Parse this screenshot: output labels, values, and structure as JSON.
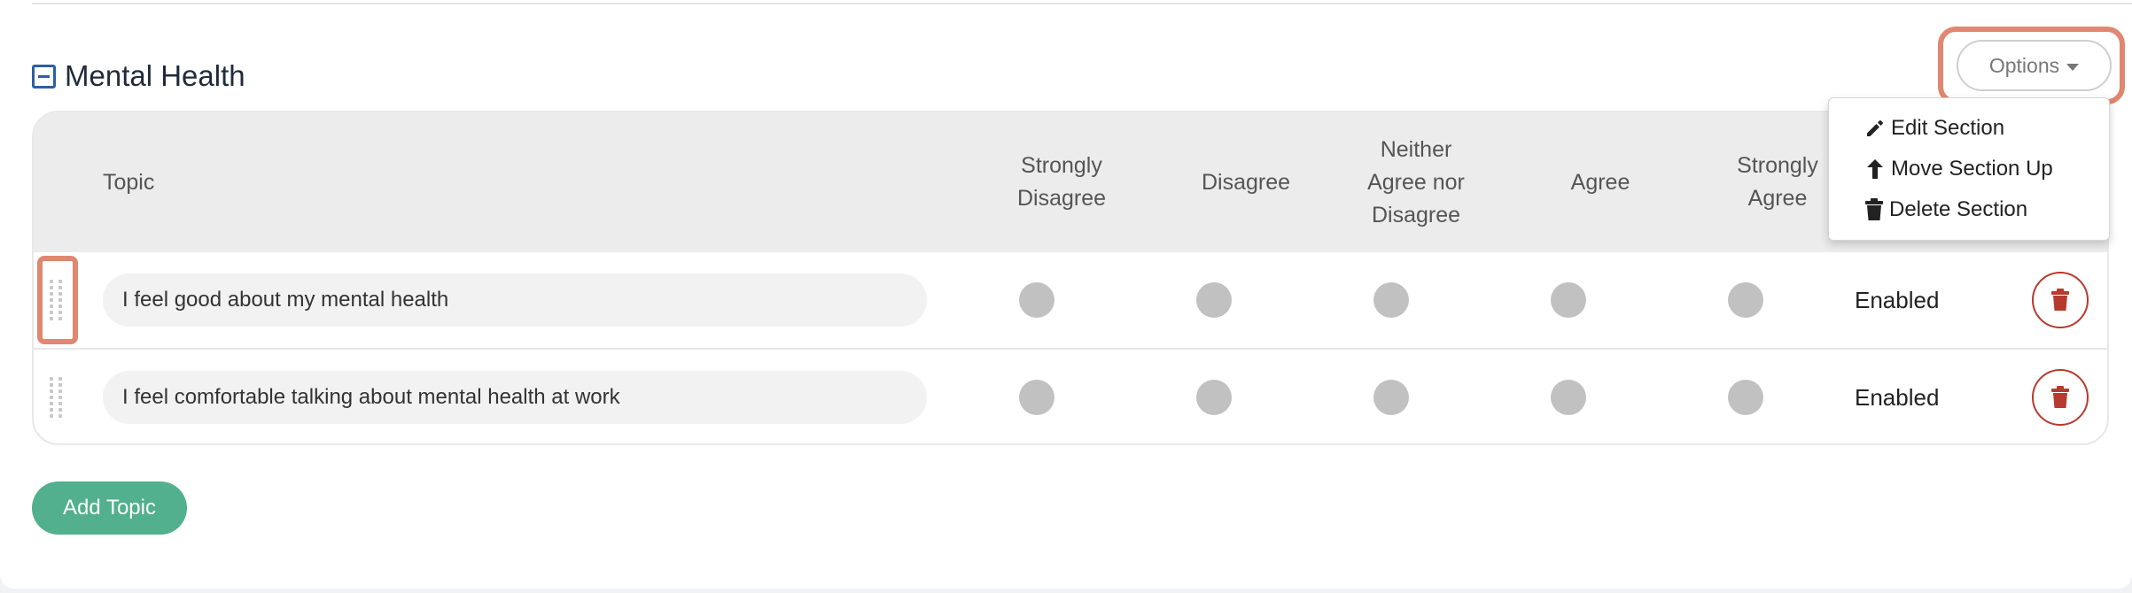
{
  "section": {
    "title": "Mental Health",
    "collapse_icon": "minus-square-icon"
  },
  "options": {
    "label": "Options",
    "caret_icon": "caret-down-icon",
    "menu": [
      {
        "label": "Edit Section",
        "icon": "pencil-icon"
      },
      {
        "label": "Move Section Up",
        "icon": "arrow-up-icon"
      },
      {
        "label": "Delete Section",
        "icon": "trash-icon"
      }
    ]
  },
  "table": {
    "headers": {
      "topic": "Topic",
      "strongly_disagree": "Strongly Disagree",
      "disagree": "Disagree",
      "neither": "Neither Agree nor Disagree",
      "agree": "Agree",
      "strongly_agree": "Strongly Agree"
    },
    "rows": [
      {
        "topic": "I feel good about my mental health",
        "status": "Enabled"
      },
      {
        "topic": "I feel comfortable talking about mental health at work",
        "status": "Enabled"
      }
    ]
  },
  "add_topic": {
    "label": "Add Topic"
  },
  "colors": {
    "accent_green": "#52b08f",
    "danger_red": "#b63a2e",
    "highlight_orange": "#e08770",
    "link_blue": "#2b5fa6",
    "header_gray": "#ececed"
  }
}
